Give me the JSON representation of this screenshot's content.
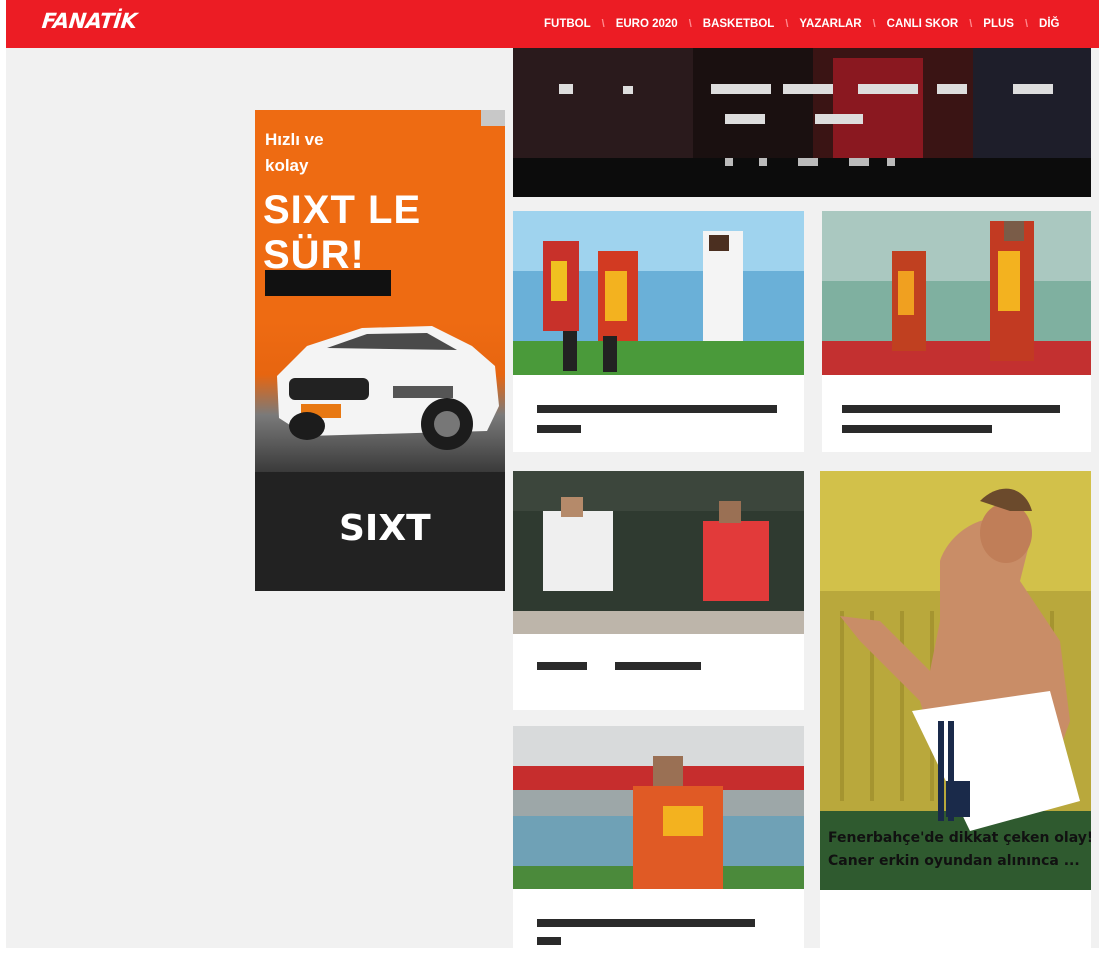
{
  "header": {
    "logo": "FANATİK",
    "nav": [
      "FUTBOL",
      "EURO 2020",
      "BASKETBOL",
      "YAZARLAR",
      "CANLI SKOR",
      "PLUS",
      "DİĞ"
    ]
  },
  "ad": {
    "line1": "Hızlı ve",
    "line2": "kolay",
    "headline": "SIXT LE SÜR!",
    "brand": "SIXT",
    "colors": {
      "orange": "#ee6b12",
      "dark": "#222222"
    }
  },
  "cards": {
    "featured_title_line1": "Fenerbahçe'de dikkat çeken olay!",
    "featured_title_line2": "Caner erkin oyundan alınınca ..."
  },
  "colors": {
    "brand_red": "#ec1c24",
    "page_bg": "#f1f1f1"
  }
}
